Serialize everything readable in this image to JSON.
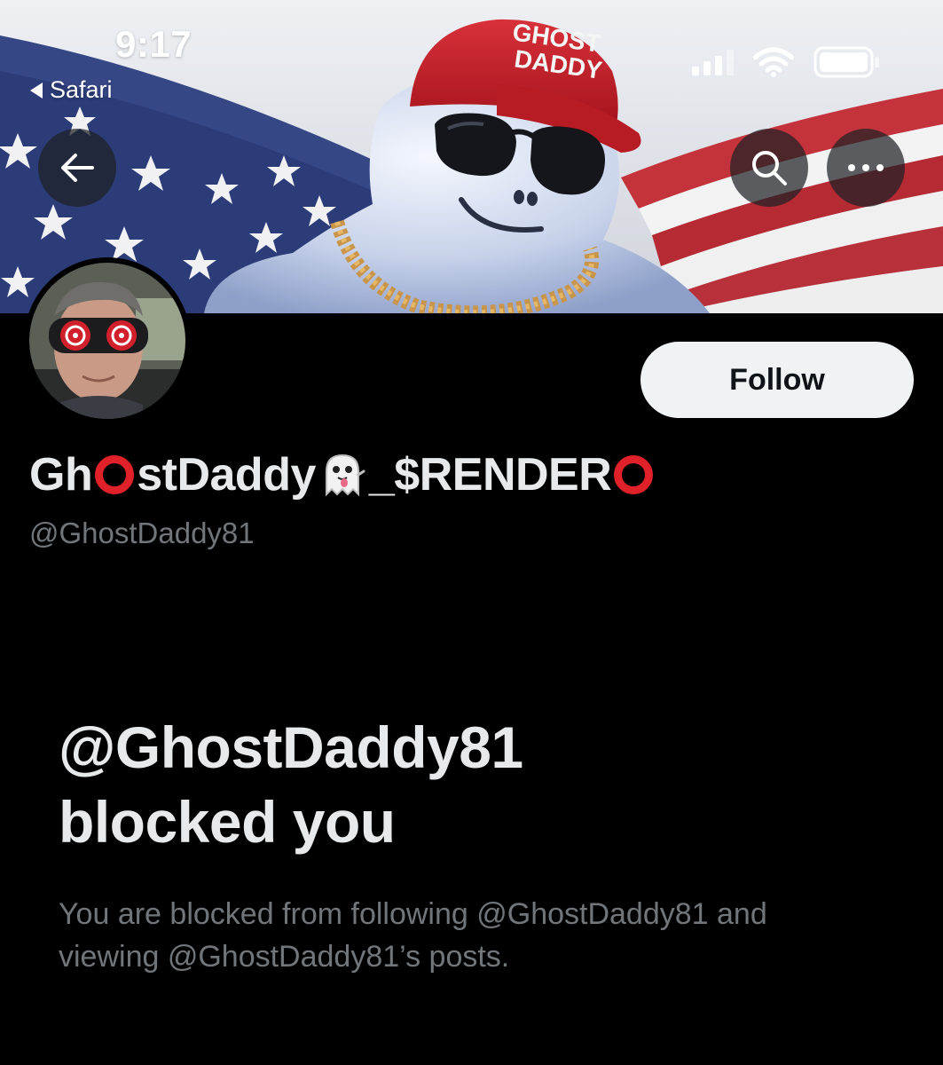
{
  "status_bar": {
    "time": "9:17",
    "back_app": "Safari"
  },
  "banner": {
    "cap_text_line1": "GHOST",
    "cap_text_line2": "DADDY"
  },
  "header_buttons": {
    "back_icon": "arrow-left-icon",
    "search_icon": "search-icon",
    "more_icon": "more-icon"
  },
  "profile": {
    "display_name_part1": "Gh",
    "display_name_part2": "stDaddy",
    "display_name_part3": "_$RENDER",
    "handle": "@GhostDaddy81",
    "follow_label": "Follow"
  },
  "blocked": {
    "title_line1": "@GhostDaddy81",
    "title_line2": "blocked you",
    "body": "You are blocked from following @GhostDaddy81 and viewing @GhostDaddy81’s posts."
  },
  "colors": {
    "background": "#000000",
    "ring_red": "#e0212a",
    "follow_bg": "#eff3f4",
    "secondary_text": "#71767b"
  }
}
